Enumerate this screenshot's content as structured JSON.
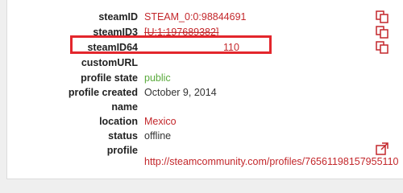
{
  "fields": {
    "steamid": {
      "label": "steamID",
      "value": "STEAM_0:0:98844691"
    },
    "steamid3": {
      "label": "steamID3",
      "value": "[U:1:197689382]"
    },
    "steamid64": {
      "label": "steamID64",
      "value": "110"
    },
    "customurl": {
      "label": "customURL",
      "value": ""
    },
    "profile_state": {
      "label": "profile state",
      "value": "public"
    },
    "profile_created": {
      "label": "profile created",
      "value": "October 9, 2014"
    },
    "name": {
      "label": "name",
      "value": ""
    },
    "location": {
      "label": "location",
      "value": "Mexico"
    },
    "status": {
      "label": "status",
      "value": "offline"
    },
    "profile": {
      "label": "profile",
      "value": "http://steamcommunity.com/profiles/76561198157955110"
    }
  },
  "colors": {
    "link_red": "#c3272b",
    "public_green": "#5aaa3c",
    "highlight_red": "#e3262c"
  },
  "icons": {
    "copy": "copy-icon",
    "external_link": "external-link-icon"
  }
}
